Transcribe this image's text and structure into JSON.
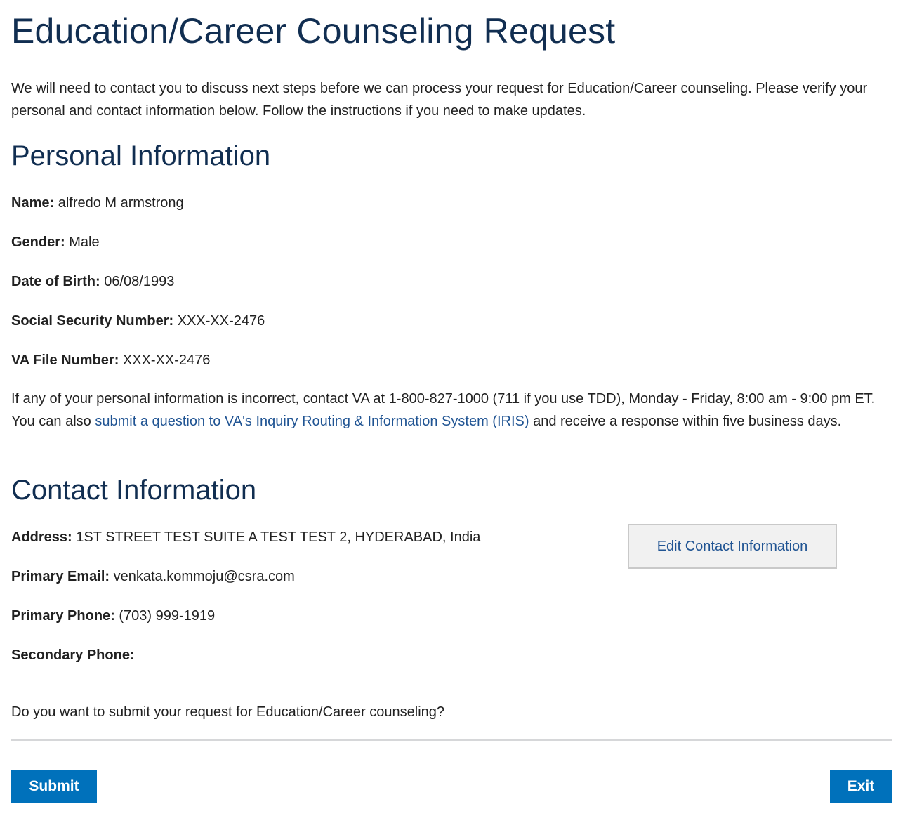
{
  "page": {
    "title": "Education/Career Counseling Request",
    "intro": "We will need to contact you to discuss next steps before we can process your request for Education/Career counseling. Please verify your personal and contact information below. Follow the instructions if you need to make updates."
  },
  "personal": {
    "heading": "Personal Information",
    "name_label": "Name:",
    "name_value": " alfredo M armstrong",
    "gender_label": "Gender:",
    "gender_value": " Male",
    "dob_label": "Date of Birth:",
    "dob_value": " 06/08/1993",
    "ssn_label": "Social Security Number:",
    "ssn_value": " XXX-XX-2476",
    "va_file_label": "VA File Number:",
    "va_file_value": " XXX-XX-2476",
    "notice_before_link": "If any of your personal information is incorrect, contact VA at 1-800-827-1000 (711 if you use TDD), Monday - Friday, 8:00 am - 9:00 pm ET. You can also ",
    "notice_link": "submit a question to VA's Inquiry Routing & Information System (IRIS)",
    "notice_after_link": " and receive a response within five business days."
  },
  "contact": {
    "heading": "Contact Information",
    "address_label": "Address:",
    "address_value": " 1ST STREET TEST SUITE A TEST TEST 2, HYDERABAD, India",
    "email_label": "Primary Email:",
    "email_value": " venkata.kommoju@csra.com",
    "primary_phone_label": "Primary Phone:",
    "primary_phone_value": " (703) 999-1919",
    "secondary_phone_label": "Secondary Phone:",
    "secondary_phone_value": "",
    "edit_button": "Edit Contact Information"
  },
  "footer": {
    "question": "Do you want to submit your request for Education/Career counseling?",
    "submit_button": "Submit",
    "exit_button": "Exit"
  },
  "colors": {
    "heading": "#112e51",
    "link": "#205493",
    "primary_button": "#0071bb",
    "secondary_button_bg": "#f1f1f1",
    "divider": "#d6d7d9"
  }
}
